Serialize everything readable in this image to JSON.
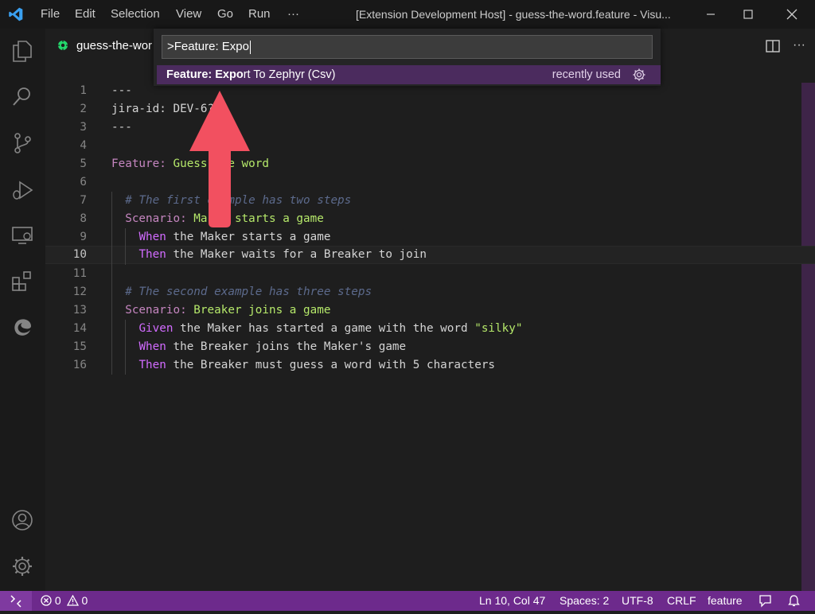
{
  "titlebar": {
    "menus": [
      "File",
      "Edit",
      "Selection",
      "View",
      "Go",
      "Run",
      "···"
    ],
    "title": "[Extension Development Host] - guess-the-word.feature - Visu..."
  },
  "tab": {
    "label": "guess-the-wor"
  },
  "palette": {
    "input_value": ">Feature: Expo",
    "result": {
      "match": "Feature: Expo",
      "rest": "rt To Zephyr (Csv)",
      "hint": "recently used"
    }
  },
  "editor": {
    "current_line": 10,
    "lines": [
      {
        "n": "1",
        "text": "---"
      },
      {
        "n": "2",
        "text": "jira-id: DEV-6?"
      },
      {
        "n": "3",
        "text": "---"
      },
      {
        "n": "4",
        "text": ""
      },
      {
        "n": "5",
        "kw": "Feature:",
        "rest": " Guess the word"
      },
      {
        "n": "6",
        "text": ""
      },
      {
        "n": "7",
        "comment": "# The first example has two steps"
      },
      {
        "n": "8",
        "kw": "Scenario:",
        "rest": " Maker starts a game"
      },
      {
        "n": "9",
        "step": "When",
        "rest": " the Maker starts a game"
      },
      {
        "n": "10",
        "step": "Then",
        "rest": " the Maker waits for a Breaker to join"
      },
      {
        "n": "11",
        "text": ""
      },
      {
        "n": "12",
        "comment": "# The second example has three steps"
      },
      {
        "n": "13",
        "kw": "Scenario:",
        "rest": " Breaker joins a game"
      },
      {
        "n": "14",
        "step": "Given",
        "rest": " the Maker has started a game with the word ",
        "str": "\"silky\""
      },
      {
        "n": "15",
        "step": "When",
        "rest": " the Breaker joins the Maker's game"
      },
      {
        "n": "16",
        "step": "Then",
        "rest": " the Breaker must guess a word with 5 characters"
      }
    ]
  },
  "statusbar": {
    "errors": "0",
    "warnings": "0",
    "position": "Ln 10, Col 47",
    "spaces": "Spaces: 2",
    "encoding": "UTF-8",
    "eol": "CRLF",
    "language": "feature"
  },
  "colors": {
    "accent": "#6d2a8c",
    "palette_selection": "#4b2b5e",
    "arrow": "#f25060",
    "keyword": "#c586c0",
    "string": "#b5e86a"
  }
}
